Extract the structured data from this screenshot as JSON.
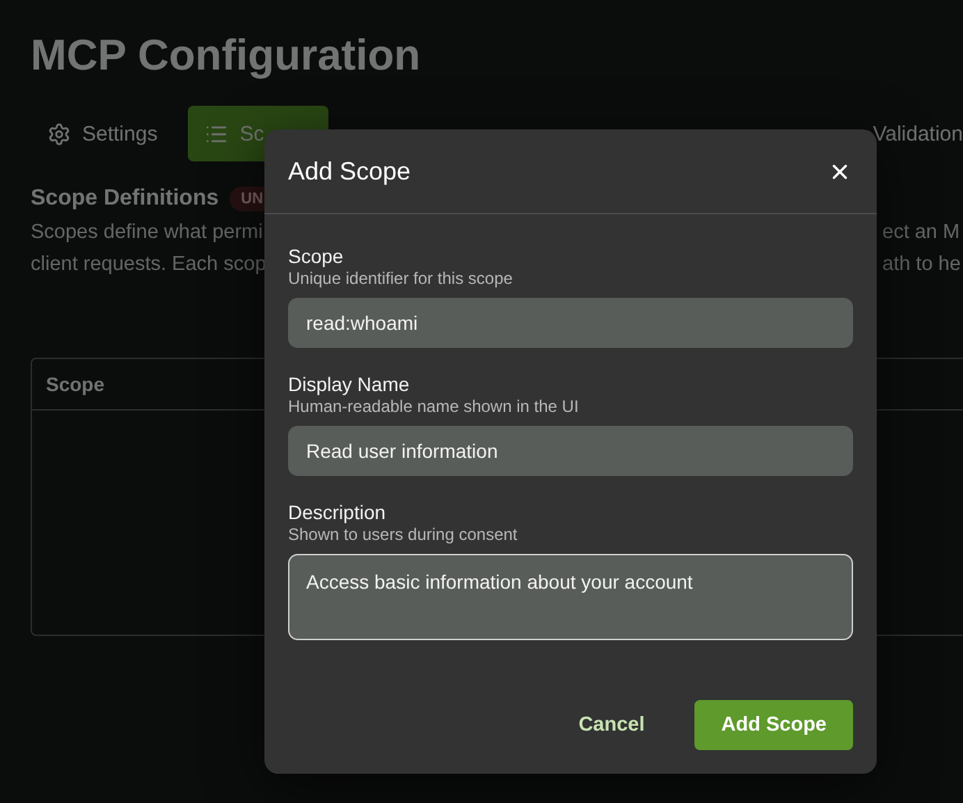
{
  "page": {
    "title": "MCP Configuration",
    "tabs": [
      {
        "label": "Settings",
        "kind": "settings",
        "selected": false
      },
      {
        "label": "Sc",
        "kind": "scopes",
        "selected": true
      },
      {
        "label": "Validation",
        "kind": "plain",
        "selected": false
      }
    ],
    "section": {
      "heading": "Scope Definitions",
      "badge": "UN",
      "description_left": [
        "Scopes define what permi",
        "client requests. Each scop"
      ],
      "description_right": [
        "ect an M",
        "ath to he"
      ]
    },
    "table": {
      "columns": [
        "Scope"
      ]
    }
  },
  "dialog": {
    "title": "Add Scope",
    "fields": [
      {
        "label": "Scope",
        "hint": "Unique identifier for this scope",
        "value": "read:whoami",
        "kind": "input",
        "focused": false
      },
      {
        "label": "Display Name",
        "hint": "Human-readable name shown in the UI",
        "value": "Read user information",
        "kind": "input",
        "focused": false
      },
      {
        "label": "Description",
        "hint": "Shown to users during consent",
        "value": "Access basic information about your account",
        "kind": "textarea",
        "focused": true
      }
    ],
    "buttons": [
      {
        "label": "Cancel",
        "kind": "secondary"
      },
      {
        "label": "Add Scope",
        "kind": "primary"
      }
    ]
  }
}
